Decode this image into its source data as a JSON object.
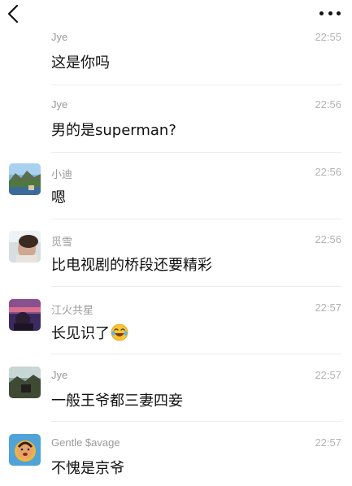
{
  "toolbar": {
    "back_icon": "chevron-left-icon",
    "more_icon": "more-dots-icon"
  },
  "messages": [
    {
      "sender": "Jye",
      "time": "22:55",
      "text": "这是你吗"
    },
    {
      "sender": "Jye",
      "time": "22:56",
      "text": "男的是superman?"
    },
    {
      "sender": "小迪",
      "time": "22:56",
      "text": "嗯"
    },
    {
      "sender": "觅雪",
      "time": "22:56",
      "text": "比电视剧的桥段还要精彩"
    },
    {
      "sender": "江火共星",
      "time": "22:57",
      "text": "长见识了"
    },
    {
      "sender": "Jye",
      "time": "22:57",
      "text": "一般王爷都三妻四妾"
    },
    {
      "sender": "Gentle $avage",
      "time": "22:57",
      "text": "不愧是京爷"
    }
  ],
  "colors": {
    "sender": "#9a9a9a",
    "time": "#b3b3b3",
    "divider": "#ececec"
  }
}
